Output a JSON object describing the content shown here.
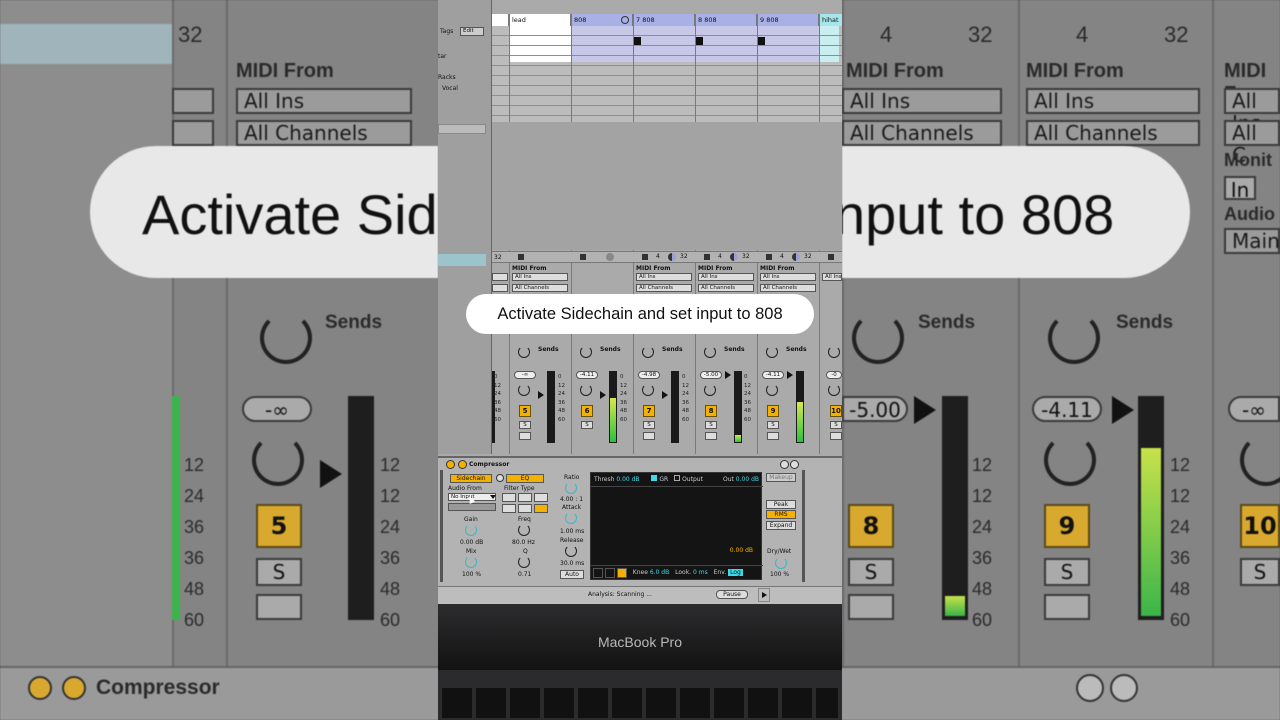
{
  "overlay": {
    "caption": "Activate Sidechain and set input to 808",
    "bg_caption_left": "Activate Sid",
    "bg_caption_right": "nput to 808"
  },
  "background": {
    "midi_from": "MIDI From",
    "all_ins": "All Ins",
    "all_channels": "All Channels",
    "sends": "Sends",
    "monitor": "Monit",
    "in": "In",
    "audio": "Audio",
    "main": "Main",
    "num_32": "32",
    "num_4": "4",
    "vol_inf": "-∞",
    "vol_500": "-5.00",
    "vol_411": "-4.11",
    "track5": "5",
    "track8": "8",
    "track9": "9",
    "track10": "10",
    "solo": "S",
    "scale": [
      "12",
      "24",
      "36",
      "48",
      "60"
    ],
    "compressor_title": "Compressor",
    "all_short": "All C",
    "a_letter": "A"
  },
  "browser": {
    "tags": "Tags",
    "edit": "Edit",
    "tar": "tar",
    "racks": "Racks",
    "vocal": "Vocal"
  },
  "tracks": [
    {
      "name": "lead",
      "num": "5",
      "vol": "-∞",
      "meter": 0
    },
    {
      "name": "808",
      "num": "6",
      "vol": "-4.11",
      "meter": 0.62
    },
    {
      "name": "7 808",
      "num": "7",
      "vol": "-4.98",
      "meter": 0
    },
    {
      "name": "8 808",
      "num": "8",
      "vol": "-5.00",
      "meter": 0.1
    },
    {
      "name": "9 808",
      "num": "9",
      "vol": "-4.11",
      "meter": 0.55
    },
    {
      "name": "hihat",
      "num": "10",
      "vol": "-0",
      "meter": 0
    }
  ],
  "mixer": {
    "midi_from": "MIDI From",
    "all_ins": "All Ins",
    "all_channels": "All Channels",
    "sends": "Sends",
    "solo": "S",
    "num_32": "32",
    "num_4": "4",
    "scale": [
      "0",
      "12",
      "24",
      "36",
      "48",
      "60"
    ]
  },
  "compressor": {
    "title": "Compressor",
    "sidechain": "Sidechain",
    "eq": "EQ",
    "audio_from": "Audio From",
    "no_input": "No Input",
    "filter_type": "Filter Type",
    "gain": "Gain",
    "gain_val": "0.00 dB",
    "mix": "Mix",
    "mix_val": "100 %",
    "freq": "Freq",
    "freq_val": "80.0 Hz",
    "q": "Q",
    "q_val": "0.71",
    "ratio": "Ratio",
    "ratio_val": "4.00 : 1",
    "attack": "Attack",
    "attack_val": "1.00 ms",
    "release": "Release",
    "release_val": "30.0 ms",
    "auto": "Auto",
    "thresh": "Thresh",
    "thresh_val": "0.00 dB",
    "gr": "GR",
    "output_lbl": "Output",
    "out": "Out",
    "out_val": "0.00 dB",
    "disp_val": "0.00 dB",
    "knee": "Knee",
    "knee_val": "6.0 dB",
    "look": "Look.",
    "look_val": "0 ms",
    "env": "Env.",
    "log": "Log",
    "makeup": "Makeup",
    "peak": "Peak",
    "rms": "RMS",
    "expand": "Expand",
    "drywet": "Dry/Wet",
    "drywet_val": "100 %"
  },
  "status": {
    "analysis": "Analysis: Scanning ...",
    "pause": "Pause"
  },
  "laptop": {
    "label": "MacBook Pro"
  }
}
